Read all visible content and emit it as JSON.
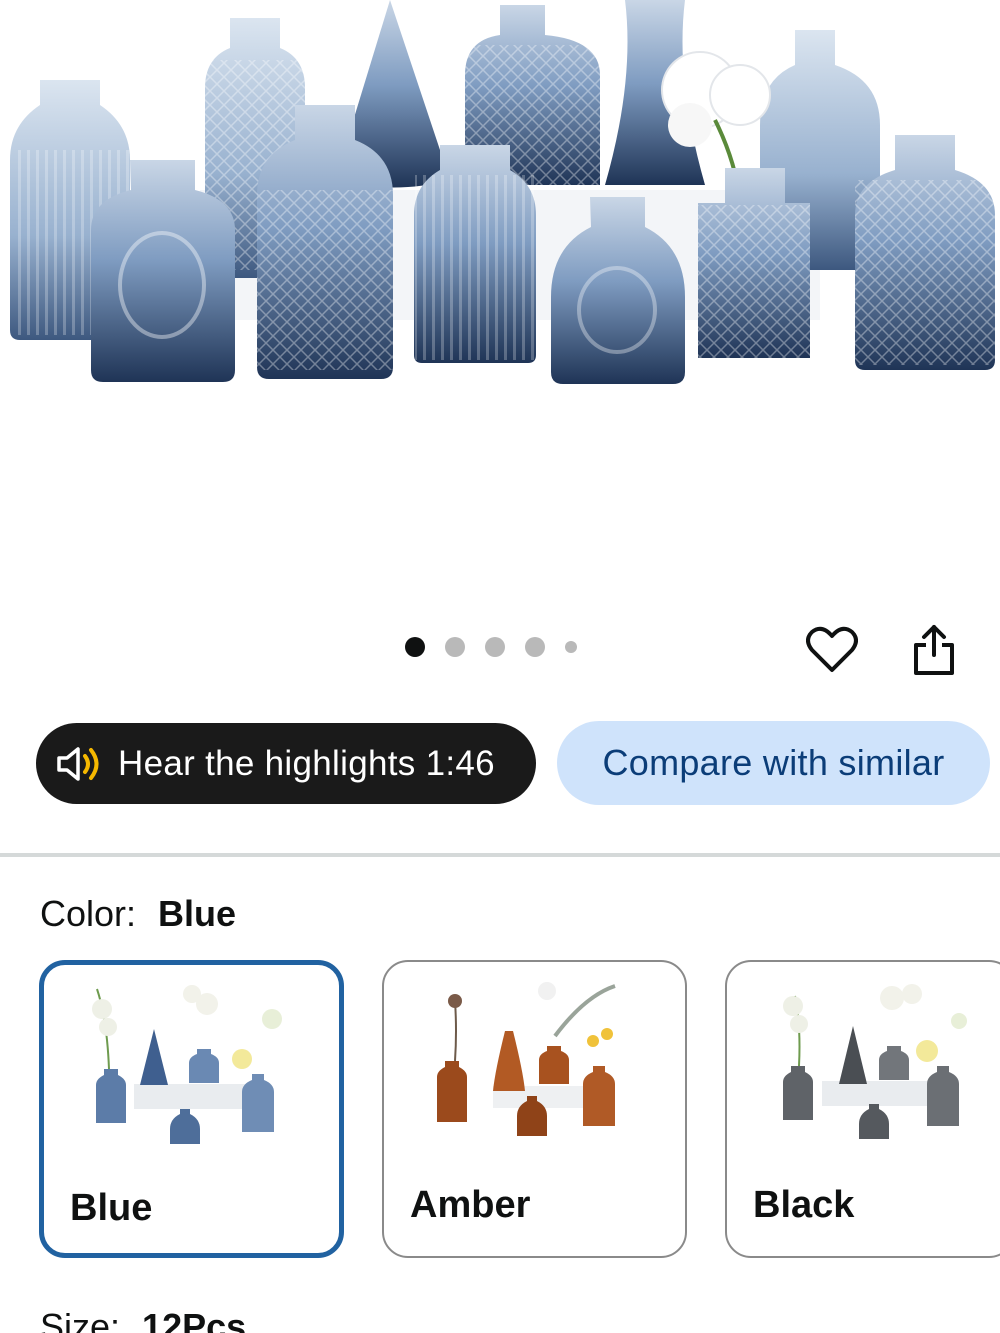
{
  "gallery": {
    "dot_count": 5,
    "active_index": 0
  },
  "actions": {
    "hear_highlights_label": "Hear the highlights 1:46",
    "compare_label": "Compare with similar"
  },
  "variations": {
    "color": {
      "label": "Color:",
      "selected": "Blue",
      "options": [
        {
          "name": "Blue",
          "selected": true,
          "tint": "#4a6a92"
        },
        {
          "name": "Amber",
          "selected": false,
          "tint": "#a4501c"
        },
        {
          "name": "Black",
          "selected": false,
          "tint": "#55595e"
        }
      ]
    },
    "size": {
      "label": "Size:",
      "selected": "12Pcs"
    }
  },
  "colors": {
    "accent_selected_border": "#2162a1",
    "compare_bg": "#cfe3fb",
    "compare_text": "#0b3d78",
    "hear_bg": "#1a1a1a",
    "speaker_accent": "#f5b800"
  }
}
